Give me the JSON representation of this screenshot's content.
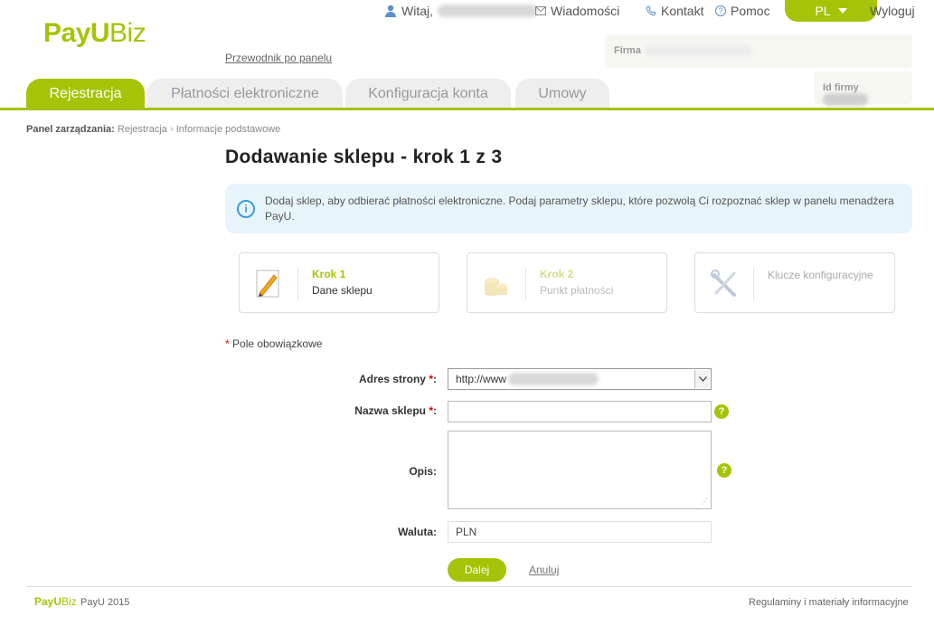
{
  "header": {
    "logo_main": "PayU",
    "logo_sub": "Biz",
    "greeting": "Witaj,",
    "messages": "Wiadomości",
    "contact": "Kontakt",
    "help": "Pomoc",
    "lang": "PL",
    "logout": "Wyloguj",
    "guide_link": "Przewodnik po panelu",
    "firm_label": "Firma",
    "firm_id_label": "Id firmy"
  },
  "tabs": [
    {
      "label": "Rejestracja"
    },
    {
      "label": "Płatności elektroniczne"
    },
    {
      "label": "Konfiguracja konta"
    },
    {
      "label": "Umowy"
    }
  ],
  "breadcrumb": {
    "root": "Panel zarządzania:",
    "level1": "Rejestracja",
    "sep": "›",
    "level2": "Informacje podstawowe"
  },
  "page_title": "Dodawanie sklepu - krok 1 z 3",
  "info_text": "Dodaj sklep, aby odbierać płatności elektroniczne. Podaj parametry sklepu, które pozwolą Ci rozpoznać sklep w panelu menadżera PayU.",
  "steps": [
    {
      "title": "Krok 1",
      "subtitle": "Dane sklepu",
      "icon": "pencil-icon"
    },
    {
      "title": "Krok 2",
      "subtitle": "Punkt płatności",
      "icon": "coins-icon"
    },
    {
      "title": "",
      "subtitle": "Klucze konfiguracyjne",
      "icon": "tools-icon"
    }
  ],
  "required_note": "Pole obowiązkowe",
  "required_mark": "*",
  "form": {
    "address_label": "Adres strony",
    "address_value": "http://www",
    "name_label": "Nazwa sklepu",
    "name_value": "",
    "desc_label": "Opis:",
    "desc_value": "",
    "currency_label": "Waluta:",
    "currency_value": "PLN",
    "help_glyph": "?"
  },
  "actions": {
    "next": "Dalej",
    "cancel": "Anuluj"
  },
  "footer": {
    "logo": "PayU",
    "logo_sub": "Biz",
    "copyright": "PayU 2015",
    "terms": "Regulaminy i materiały informacyjne"
  },
  "colors": {
    "accent": "#a6c307",
    "info_bg": "#e8f4fb",
    "info_icon": "#3f9bd5"
  }
}
